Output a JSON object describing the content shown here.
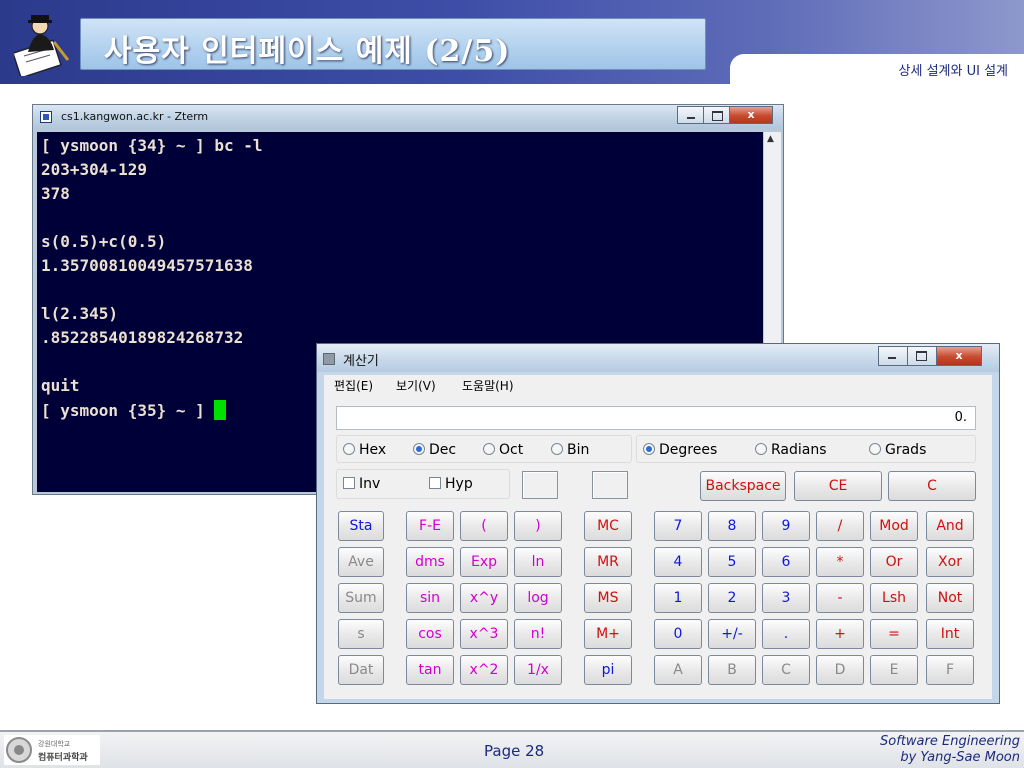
{
  "slide": {
    "title": "사용자 인터페이스 예제 (2/5)",
    "subtitle": "상세 설계와 UI 설계",
    "page": "Page 28",
    "credit_line1": "Software Engineering",
    "credit_line2": "by Yang-Sae Moon",
    "logo_line1": "강원대학교",
    "logo_line2": "컴퓨터과학과"
  },
  "terminal": {
    "window_title": "cs1.kangwon.ac.kr - Zterm",
    "lines": [
      "[ ysmoon {34} ~ ] bc -l",
      "203+304-129",
      "378",
      "",
      "s(0.5)+c(0.5)",
      "1.35700810049457571638",
      "",
      "l(2.345)",
      ".85228540189824268732",
      "",
      "quit",
      "[ ysmoon {35} ~ ] "
    ]
  },
  "calculator": {
    "window_title": "계산기",
    "menu": [
      "편집(E)",
      "보기(V)",
      "도움말(H)"
    ],
    "display": "0.",
    "number_systems": [
      "Hex",
      "Dec",
      "Oct",
      "Bin"
    ],
    "number_system_selected": "Dec",
    "angle_units": [
      "Degrees",
      "Radians",
      "Grads"
    ],
    "angle_unit_selected": "Degrees",
    "inv_label": "Inv",
    "hyp_label": "Hyp",
    "backspace": "Backspace",
    "ce": "CE",
    "c": "C",
    "stat_buttons": [
      "Sta",
      "Ave",
      "Sum",
      "s",
      "Dat"
    ],
    "sci_col1": [
      "F-E",
      "dms",
      "sin",
      "cos",
      "tan"
    ],
    "sci_col2": [
      "(",
      "Exp",
      "x^y",
      "x^3",
      "x^2"
    ],
    "sci_col3": [
      ")",
      "ln",
      "log",
      "n!",
      "1/x"
    ],
    "memory": [
      "MC",
      "MR",
      "MS",
      "M+",
      "pi"
    ],
    "keypad": [
      [
        "7",
        "8",
        "9",
        "/",
        "Mod",
        "And"
      ],
      [
        "4",
        "5",
        "6",
        "*",
        "Or",
        "Xor"
      ],
      [
        "1",
        "2",
        "3",
        "-",
        "Lsh",
        "Not"
      ],
      [
        "0",
        "+/-",
        ".",
        "+",
        "=",
        "Int"
      ],
      [
        "A",
        "B",
        "C",
        "D",
        "E",
        "F"
      ]
    ],
    "colors": {
      "blue": "#1018d8",
      "pink": "#d000d0",
      "red": "#d01010",
      "disabled": "#8a8a8a"
    }
  }
}
